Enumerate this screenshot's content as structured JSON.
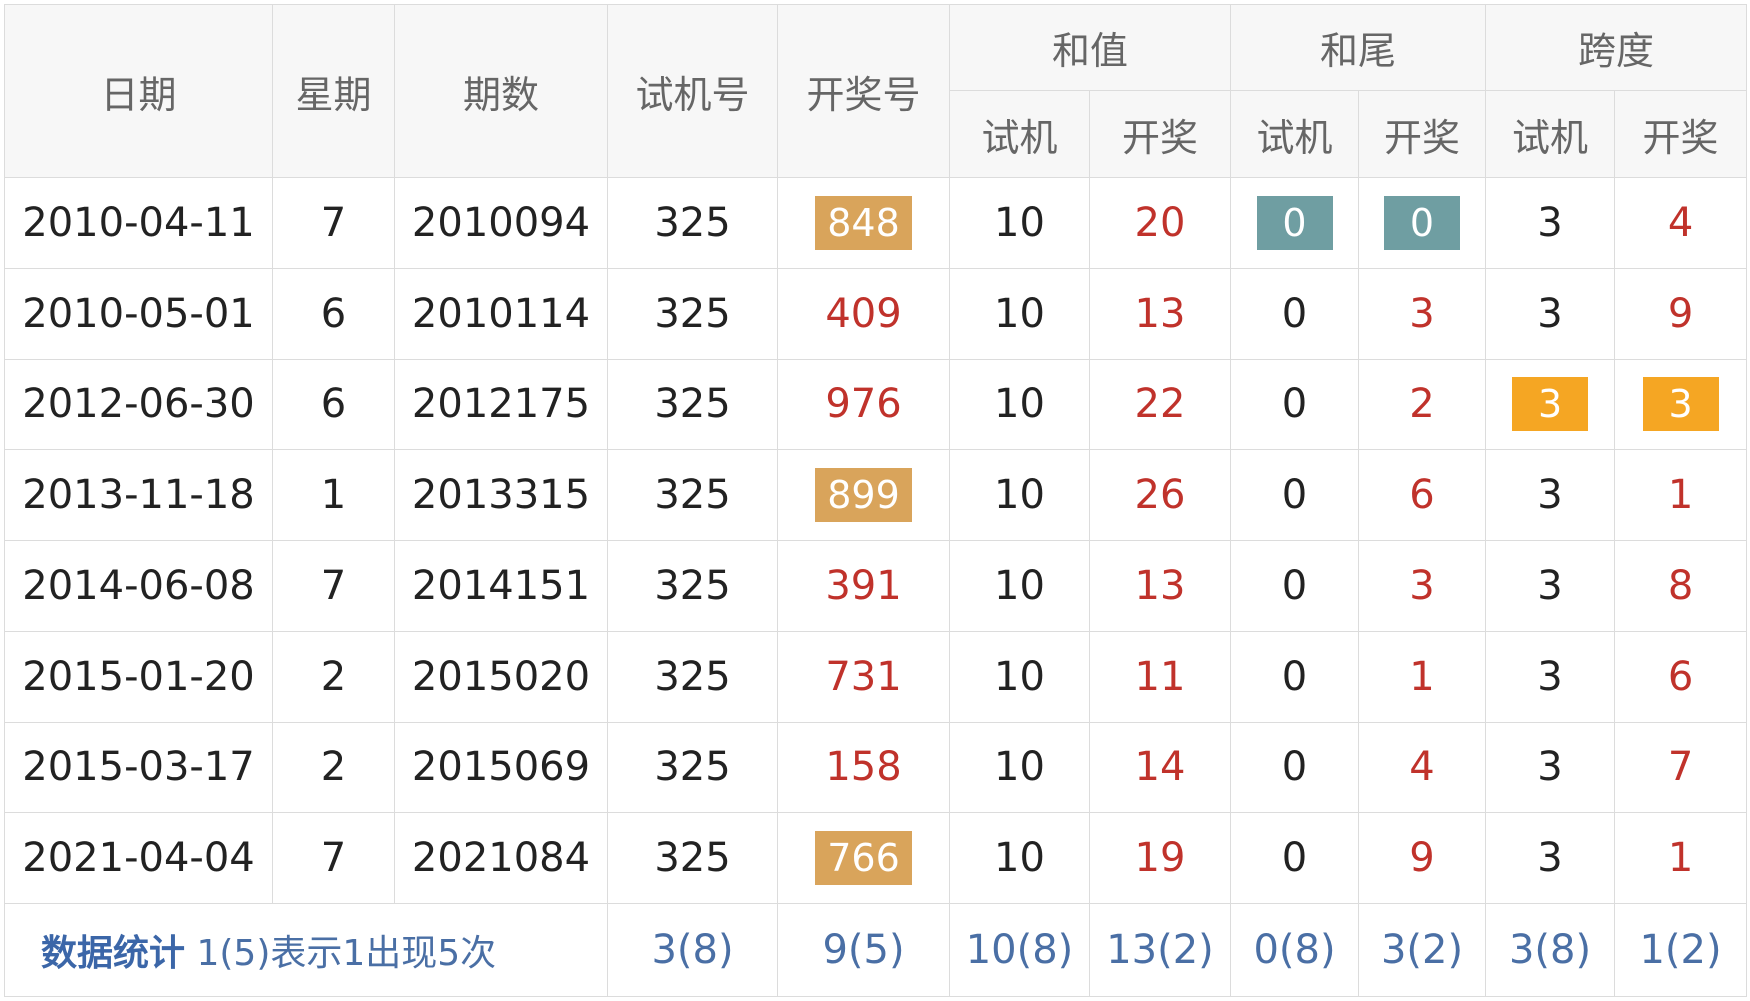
{
  "colors": {
    "header_bg": "#f7f7f7",
    "border": "#dcdcdc",
    "text_dark": "#222222",
    "text_red": "#c0322b",
    "stat_blue": "#4a6fa5",
    "box_tan": "#d9a45b",
    "box_teal": "#6f9ea2",
    "box_orange": "#f5a623"
  },
  "headers": {
    "date": "日期",
    "weekday": "星期",
    "issue": "期数",
    "trial": "试机号",
    "draw": "开奖号",
    "sum": "和值",
    "tail": "和尾",
    "span": "跨度",
    "sub_trial": "试机",
    "sub_draw": "开奖"
  },
  "rows": [
    {
      "date": "2010-04-11",
      "weekday": "7",
      "issue": "2010094",
      "trial": "325",
      "draw": "848",
      "sum_trial": "10",
      "sum_draw": "20",
      "tail_trial": "0",
      "tail_draw": "0",
      "span_trial": "3",
      "span_draw": "4"
    },
    {
      "date": "2010-05-01",
      "weekday": "6",
      "issue": "2010114",
      "trial": "325",
      "draw": "409",
      "sum_trial": "10",
      "sum_draw": "13",
      "tail_trial": "0",
      "tail_draw": "3",
      "span_trial": "3",
      "span_draw": "9"
    },
    {
      "date": "2012-06-30",
      "weekday": "6",
      "issue": "2012175",
      "trial": "325",
      "draw": "976",
      "sum_trial": "10",
      "sum_draw": "22",
      "tail_trial": "0",
      "tail_draw": "2",
      "span_trial": "3",
      "span_draw": "3"
    },
    {
      "date": "2013-11-18",
      "weekday": "1",
      "issue": "2013315",
      "trial": "325",
      "draw": "899",
      "sum_trial": "10",
      "sum_draw": "26",
      "tail_trial": "0",
      "tail_draw": "6",
      "span_trial": "3",
      "span_draw": "1"
    },
    {
      "date": "2014-06-08",
      "weekday": "7",
      "issue": "2014151",
      "trial": "325",
      "draw": "391",
      "sum_trial": "10",
      "sum_draw": "13",
      "tail_trial": "0",
      "tail_draw": "3",
      "span_trial": "3",
      "span_draw": "8"
    },
    {
      "date": "2015-01-20",
      "weekday": "2",
      "issue": "2015020",
      "trial": "325",
      "draw": "731",
      "sum_trial": "10",
      "sum_draw": "11",
      "tail_trial": "0",
      "tail_draw": "1",
      "span_trial": "3",
      "span_draw": "6"
    },
    {
      "date": "2015-03-17",
      "weekday": "2",
      "issue": "2015069",
      "trial": "325",
      "draw": "158",
      "sum_trial": "10",
      "sum_draw": "14",
      "tail_trial": "0",
      "tail_draw": "4",
      "span_trial": "3",
      "span_draw": "7"
    },
    {
      "date": "2021-04-04",
      "weekday": "7",
      "issue": "2021084",
      "trial": "325",
      "draw": "766",
      "sum_trial": "10",
      "sum_draw": "19",
      "tail_trial": "0",
      "tail_draw": "9",
      "span_trial": "3",
      "span_draw": "1"
    }
  ],
  "stats": {
    "title": "数据统计",
    "note": "1(5)表示1出现5次",
    "trial": "3(8)",
    "draw": "9(5)",
    "sum_trial": "10(8)",
    "sum_draw": "13(2)",
    "tail_trial": "0(8)",
    "tail_draw": "3(2)",
    "span_trial": "3(8)",
    "span_draw": "1(2)"
  }
}
